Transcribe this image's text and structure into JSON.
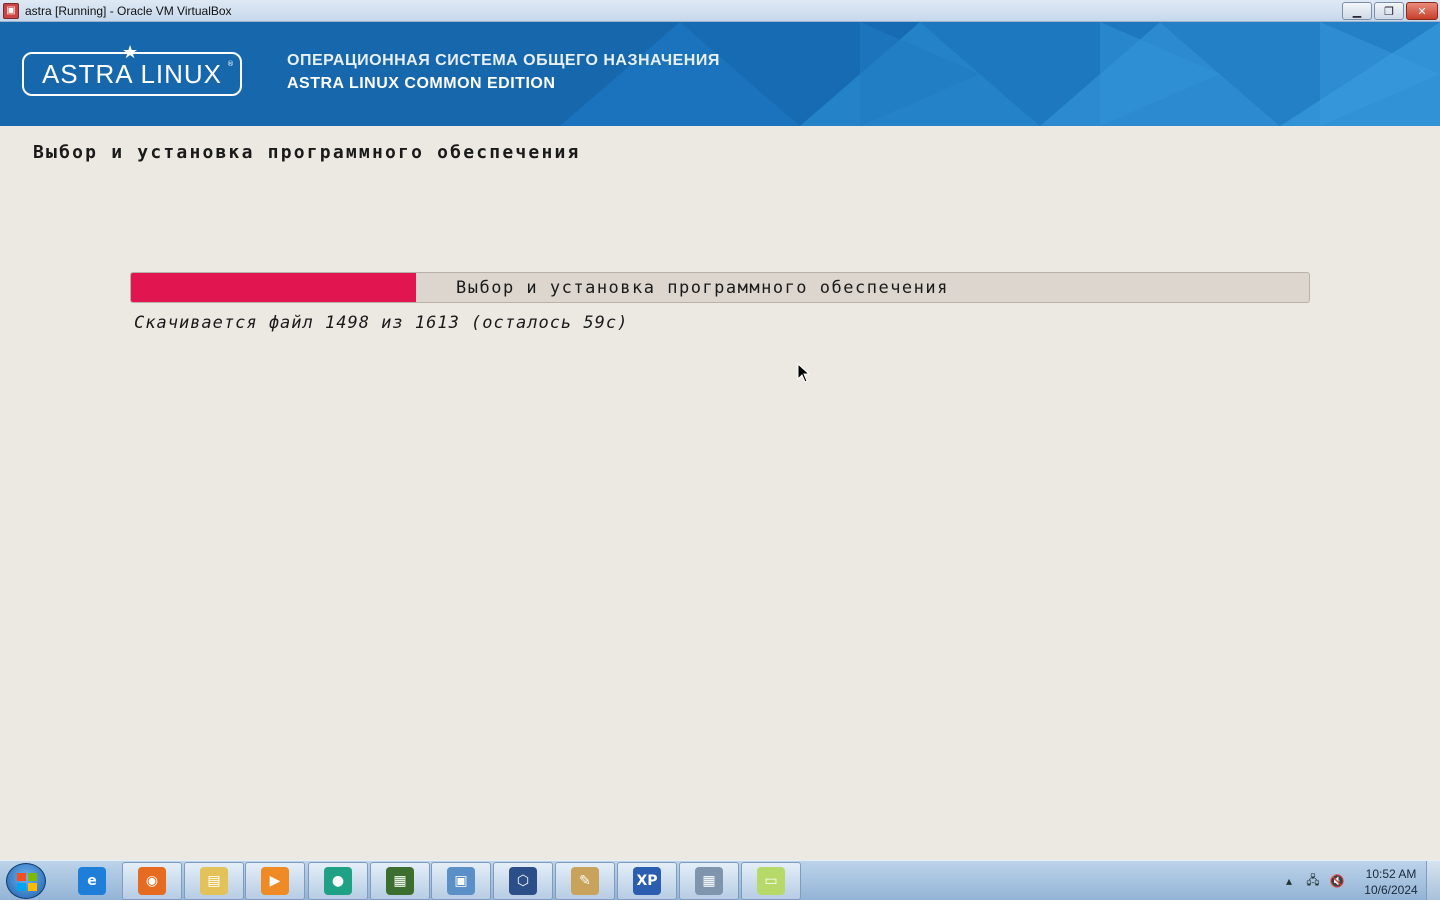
{
  "window": {
    "title": "astra [Running] - Oracle VM VirtualBox",
    "controls": [
      "minimize-icon",
      "restore-icon",
      "close-icon"
    ]
  },
  "banner": {
    "logo_text": "ASTRA LINUX",
    "line1": "ОПЕРАЦИОННАЯ СИСТЕМА ОБЩЕГО НАЗНАЧЕНИЯ",
    "line2": "ASTRA LINUX COMMON EDITION",
    "colors": {
      "background": "#1767ad"
    }
  },
  "installer": {
    "step_title": "Выбор и установка программного обеспечения",
    "progress": {
      "label": "Выбор и установка программного обеспечения",
      "fraction": 0.242,
      "fill_color": "#e1154f"
    },
    "status": "Скачивается файл 1498 из 1613 (осталось 59с)"
  },
  "taskbar": {
    "apps": [
      {
        "name": "internet-explorer-icon",
        "color": "#1f7fd8",
        "glyph": "e"
      },
      {
        "name": "firefox-icon",
        "color": "#e66a1f",
        "glyph": "◉"
      },
      {
        "name": "file-explorer-icon",
        "color": "#e3c25a",
        "glyph": "▤"
      },
      {
        "name": "media-player-icon",
        "color": "#f08a24",
        "glyph": "▶"
      },
      {
        "name": "green-app-icon",
        "color": "#1fa186",
        "glyph": "●"
      },
      {
        "name": "terminal-app-icon",
        "color": "#3b6e2f",
        "glyph": "▦"
      },
      {
        "name": "network-app-icon",
        "color": "#5b8fc8",
        "glyph": "▣"
      },
      {
        "name": "virtualbox-icon",
        "color": "#2c4f8a",
        "glyph": "⬡"
      },
      {
        "name": "paint-icon",
        "color": "#c9a25c",
        "glyph": "✎"
      },
      {
        "name": "xp-mode-icon",
        "color": "#2b5db0",
        "glyph": "XP"
      },
      {
        "name": "calculator-icon",
        "color": "#7f95ad",
        "glyph": "▦"
      },
      {
        "name": "sticky-notes-icon",
        "color": "#b7d96a",
        "glyph": "▭"
      }
    ],
    "tray": {
      "icons": [
        "show-hidden-icons-arrow",
        "network-icon",
        "volume-muted-icon"
      ],
      "time": "10:52 AM",
      "date": "10/6/2024"
    }
  }
}
